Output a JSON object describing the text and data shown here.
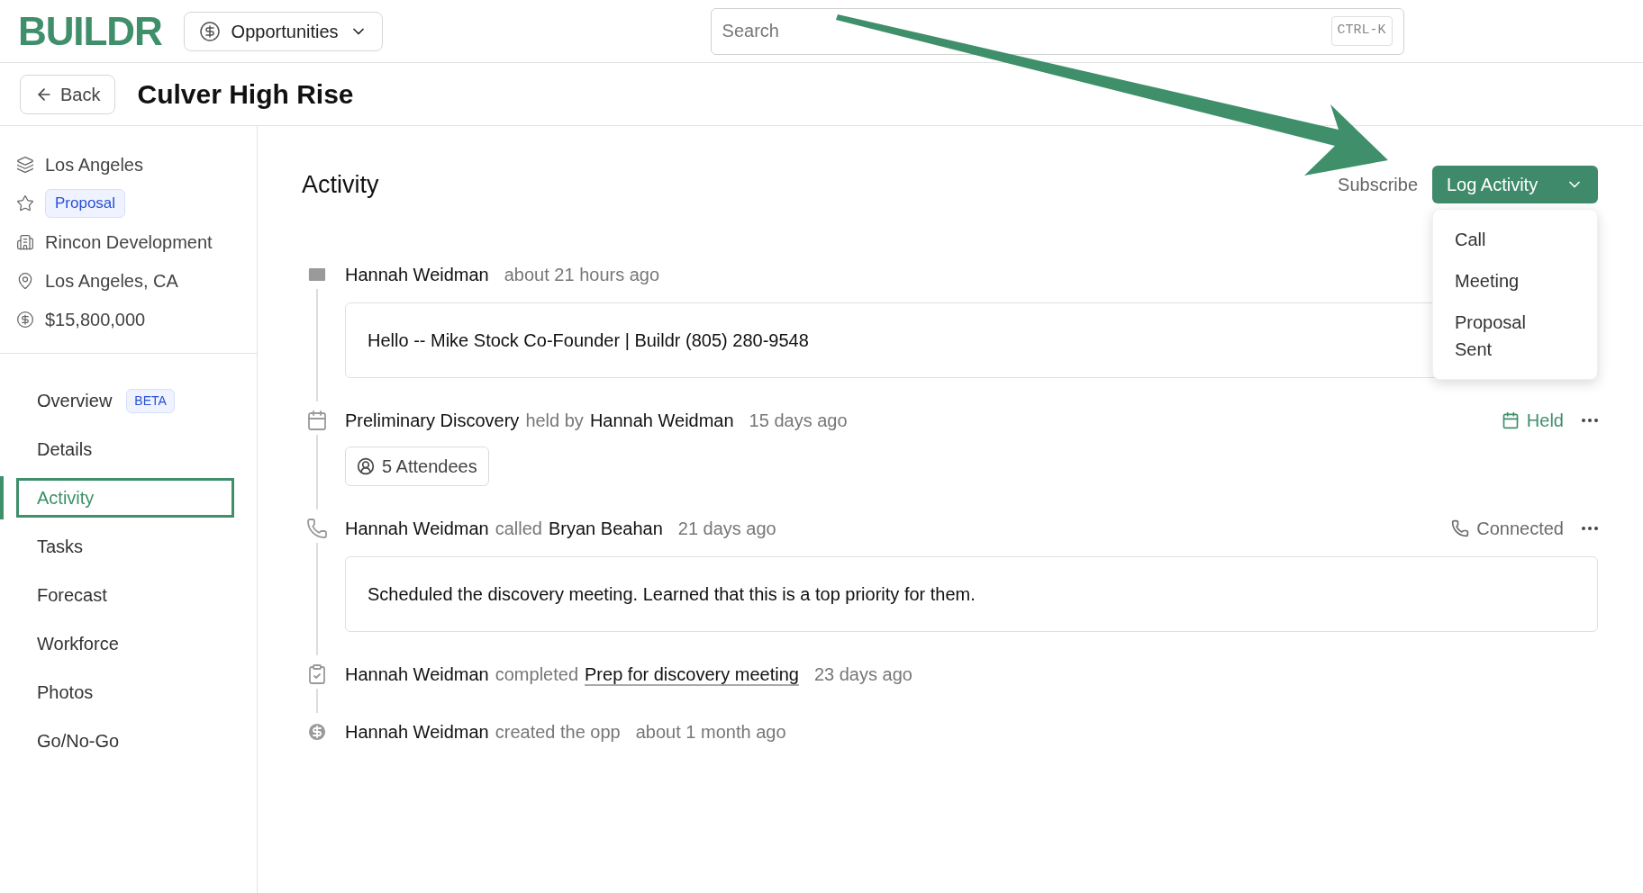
{
  "header": {
    "logo": "BUILDR",
    "module": "Opportunities",
    "search": {
      "placeholder": "Search",
      "shortcut": "CTRL-K"
    }
  },
  "page": {
    "back": "Back",
    "title": "Culver High Rise"
  },
  "sidebar": {
    "facts": [
      {
        "kind": "layers",
        "text": "Los Angeles"
      },
      {
        "kind": "stage",
        "text": "Proposal"
      },
      {
        "kind": "company",
        "text": "Rincon Development"
      },
      {
        "kind": "location",
        "text": "Los Angeles, CA"
      },
      {
        "kind": "money",
        "text": "$15,800,000"
      }
    ],
    "nav": [
      {
        "label": "Overview",
        "badge": "BETA",
        "selected": false
      },
      {
        "label": "Details",
        "selected": false
      },
      {
        "label": "Activity",
        "selected": true
      },
      {
        "label": "Tasks",
        "selected": false
      },
      {
        "label": "Forecast",
        "selected": false
      },
      {
        "label": "Workforce",
        "selected": false
      },
      {
        "label": "Photos",
        "selected": false
      },
      {
        "label": "Go/No-Go",
        "selected": false
      }
    ]
  },
  "activity": {
    "title": "Activity",
    "subscribe": "Subscribe",
    "log_button": "Log Activity",
    "menu": [
      "Call",
      "Meeting",
      "Proposal Sent"
    ],
    "items": [
      {
        "kind": "email",
        "parts": [
          {
            "kind": "strong",
            "text": "Hannah Weidman"
          }
        ],
        "time": "about 21 hours ago",
        "body": "Hello -- Mike Stock Co-Founder | Buildr (805) 280-9548"
      },
      {
        "kind": "meeting",
        "parts": [
          {
            "kind": "strong",
            "text": "Preliminary Discovery"
          },
          {
            "kind": "muted",
            "text": "held by"
          },
          {
            "kind": "strong",
            "text": "Hannah Weidman"
          }
        ],
        "time": "15 days ago",
        "status": {
          "kind": "held",
          "text": "Held"
        },
        "attendees": "5 Attendees"
      },
      {
        "kind": "call",
        "parts": [
          {
            "kind": "strong",
            "text": "Hannah Weidman"
          },
          {
            "kind": "muted",
            "text": "called"
          },
          {
            "kind": "strong",
            "text": "Bryan Beahan"
          }
        ],
        "time": "21 days ago",
        "status": {
          "kind": "connected",
          "text": "Connected"
        },
        "body": "Scheduled the discovery meeting. Learned that this is a top priority for them."
      },
      {
        "kind": "task",
        "parts": [
          {
            "kind": "strong",
            "text": "Hannah Weidman"
          },
          {
            "kind": "muted",
            "text": "completed"
          },
          {
            "kind": "link",
            "text": "Prep for discovery meeting"
          }
        ],
        "time": "23 days ago"
      },
      {
        "kind": "created",
        "parts": [
          {
            "kind": "strong",
            "text": "Hannah Weidman"
          },
          {
            "kind": "muted",
            "text": "created the opp"
          }
        ],
        "time": "about 1 month ago"
      }
    ]
  }
}
